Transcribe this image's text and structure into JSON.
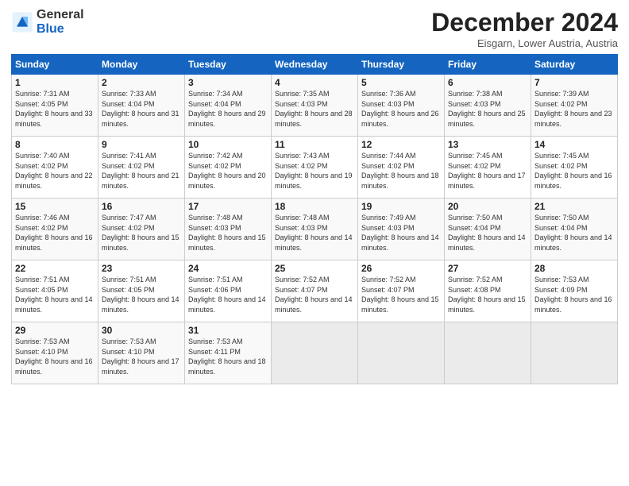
{
  "logo": {
    "general": "General",
    "blue": "Blue"
  },
  "title": "December 2024",
  "location": "Eisgarn, Lower Austria, Austria",
  "days_of_week": [
    "Sunday",
    "Monday",
    "Tuesday",
    "Wednesday",
    "Thursday",
    "Friday",
    "Saturday"
  ],
  "weeks": [
    [
      {
        "day": "1",
        "sunrise": "7:31 AM",
        "sunset": "4:05 PM",
        "daylight": "8 hours and 33 minutes."
      },
      {
        "day": "2",
        "sunrise": "7:33 AM",
        "sunset": "4:04 PM",
        "daylight": "8 hours and 31 minutes."
      },
      {
        "day": "3",
        "sunrise": "7:34 AM",
        "sunset": "4:04 PM",
        "daylight": "8 hours and 29 minutes."
      },
      {
        "day": "4",
        "sunrise": "7:35 AM",
        "sunset": "4:03 PM",
        "daylight": "8 hours and 28 minutes."
      },
      {
        "day": "5",
        "sunrise": "7:36 AM",
        "sunset": "4:03 PM",
        "daylight": "8 hours and 26 minutes."
      },
      {
        "day": "6",
        "sunrise": "7:38 AM",
        "sunset": "4:03 PM",
        "daylight": "8 hours and 25 minutes."
      },
      {
        "day": "7",
        "sunrise": "7:39 AM",
        "sunset": "4:02 PM",
        "daylight": "8 hours and 23 minutes."
      }
    ],
    [
      {
        "day": "8",
        "sunrise": "7:40 AM",
        "sunset": "4:02 PM",
        "daylight": "8 hours and 22 minutes."
      },
      {
        "day": "9",
        "sunrise": "7:41 AM",
        "sunset": "4:02 PM",
        "daylight": "8 hours and 21 minutes."
      },
      {
        "day": "10",
        "sunrise": "7:42 AM",
        "sunset": "4:02 PM",
        "daylight": "8 hours and 20 minutes."
      },
      {
        "day": "11",
        "sunrise": "7:43 AM",
        "sunset": "4:02 PM",
        "daylight": "8 hours and 19 minutes."
      },
      {
        "day": "12",
        "sunrise": "7:44 AM",
        "sunset": "4:02 PM",
        "daylight": "8 hours and 18 minutes."
      },
      {
        "day": "13",
        "sunrise": "7:45 AM",
        "sunset": "4:02 PM",
        "daylight": "8 hours and 17 minutes."
      },
      {
        "day": "14",
        "sunrise": "7:45 AM",
        "sunset": "4:02 PM",
        "daylight": "8 hours and 16 minutes."
      }
    ],
    [
      {
        "day": "15",
        "sunrise": "7:46 AM",
        "sunset": "4:02 PM",
        "daylight": "8 hours and 16 minutes."
      },
      {
        "day": "16",
        "sunrise": "7:47 AM",
        "sunset": "4:02 PM",
        "daylight": "8 hours and 15 minutes."
      },
      {
        "day": "17",
        "sunrise": "7:48 AM",
        "sunset": "4:03 PM",
        "daylight": "8 hours and 15 minutes."
      },
      {
        "day": "18",
        "sunrise": "7:48 AM",
        "sunset": "4:03 PM",
        "daylight": "8 hours and 14 minutes."
      },
      {
        "day": "19",
        "sunrise": "7:49 AM",
        "sunset": "4:03 PM",
        "daylight": "8 hours and 14 minutes."
      },
      {
        "day": "20",
        "sunrise": "7:50 AM",
        "sunset": "4:04 PM",
        "daylight": "8 hours and 14 minutes."
      },
      {
        "day": "21",
        "sunrise": "7:50 AM",
        "sunset": "4:04 PM",
        "daylight": "8 hours and 14 minutes."
      }
    ],
    [
      {
        "day": "22",
        "sunrise": "7:51 AM",
        "sunset": "4:05 PM",
        "daylight": "8 hours and 14 minutes."
      },
      {
        "day": "23",
        "sunrise": "7:51 AM",
        "sunset": "4:05 PM",
        "daylight": "8 hours and 14 minutes."
      },
      {
        "day": "24",
        "sunrise": "7:51 AM",
        "sunset": "4:06 PM",
        "daylight": "8 hours and 14 minutes."
      },
      {
        "day": "25",
        "sunrise": "7:52 AM",
        "sunset": "4:07 PM",
        "daylight": "8 hours and 14 minutes."
      },
      {
        "day": "26",
        "sunrise": "7:52 AM",
        "sunset": "4:07 PM",
        "daylight": "8 hours and 15 minutes."
      },
      {
        "day": "27",
        "sunrise": "7:52 AM",
        "sunset": "4:08 PM",
        "daylight": "8 hours and 15 minutes."
      },
      {
        "day": "28",
        "sunrise": "7:53 AM",
        "sunset": "4:09 PM",
        "daylight": "8 hours and 16 minutes."
      }
    ],
    [
      {
        "day": "29",
        "sunrise": "7:53 AM",
        "sunset": "4:10 PM",
        "daylight": "8 hours and 16 minutes."
      },
      {
        "day": "30",
        "sunrise": "7:53 AM",
        "sunset": "4:10 PM",
        "daylight": "8 hours and 17 minutes."
      },
      {
        "day": "31",
        "sunrise": "7:53 AM",
        "sunset": "4:11 PM",
        "daylight": "8 hours and 18 minutes."
      },
      null,
      null,
      null,
      null
    ]
  ]
}
